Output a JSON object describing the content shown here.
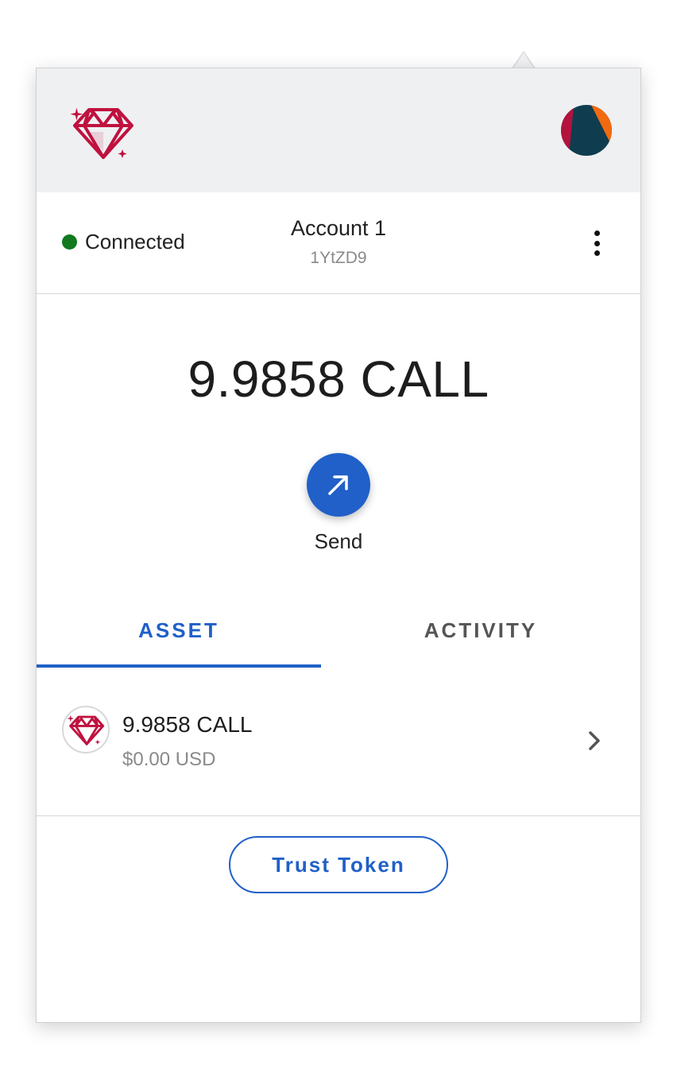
{
  "app": {
    "logo_icon": "gem-icon",
    "brand_color": "#c0113e",
    "accent_color": "#2060c8",
    "avatar_icon": "account-avatar-icon"
  },
  "account": {
    "status": "Connected",
    "status_color": "#117a1f",
    "name": "Account 1",
    "address": "1YtZD9",
    "menu_icon": "kebab-menu-icon"
  },
  "wallet": {
    "balance": "9.9858 CALL",
    "send_label": "Send",
    "send_icon": "arrow-up-right-icon"
  },
  "tabs": [
    {
      "label": "ASSET",
      "active": true
    },
    {
      "label": "ACTIVITY",
      "active": false
    }
  ],
  "assets": [
    {
      "icon": "gem-icon",
      "amount": "9.9858 CALL",
      "fiat": "$0.00 USD",
      "chevron_icon": "chevron-right-icon"
    }
  ],
  "actions": {
    "trust_token_label": "Trust Token"
  }
}
